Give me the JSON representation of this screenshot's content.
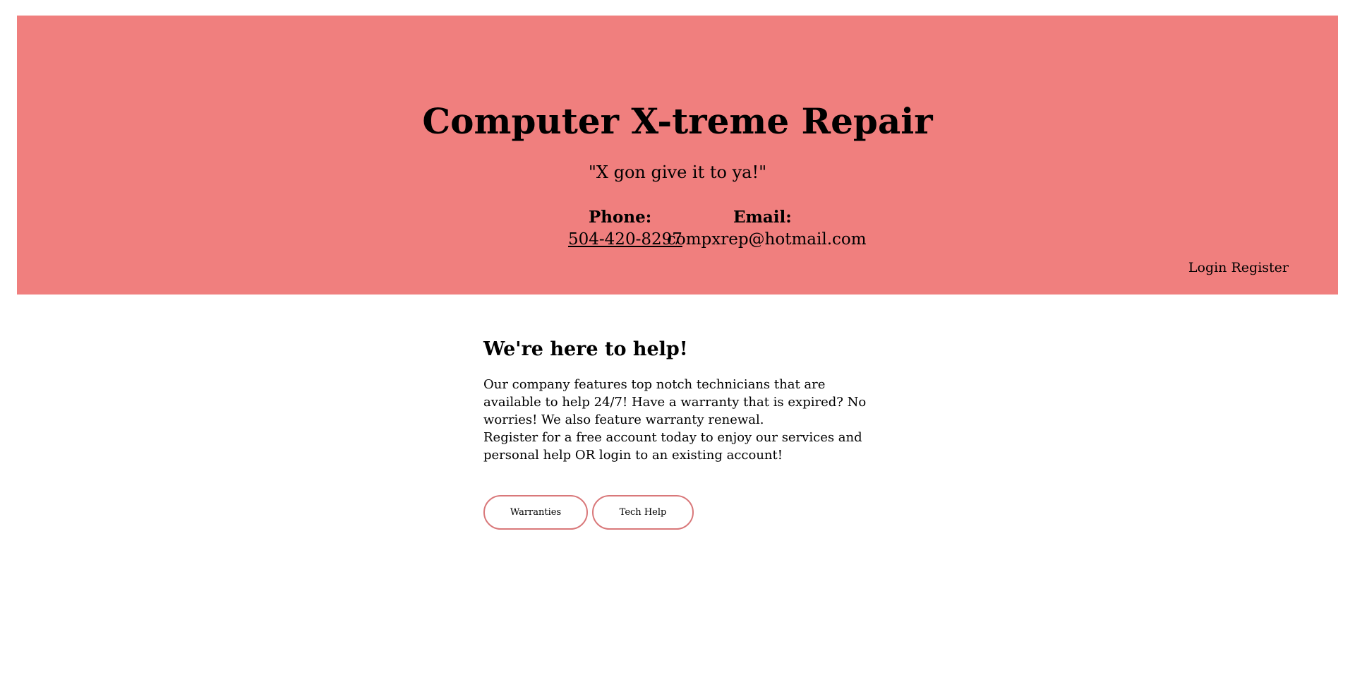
{
  "header": {
    "title": "Computer X-treme Repair",
    "tagline": "\"X gon give it to ya!\"",
    "phone_label": "Phone:",
    "phone_value": "504-420-8297",
    "email_label": "Email:",
    "email_value": "compxrep@hotmail.com",
    "login_label": "Login",
    "register_label": "Register"
  },
  "main": {
    "heading": "We're here to help!",
    "paragraph_1": "Our company features top notch technicians that are available to help 24/7! Have a warranty that is expired? No worries! We also feature warranty renewal.",
    "paragraph_2": "Register for a free account today to enjoy our services and personal help OR login to an existing account!",
    "buttons": [
      {
        "label": "Warranties"
      },
      {
        "label": "Tech Help"
      }
    ]
  },
  "colors": {
    "header_background": "#f07f7e",
    "button_border": "#d9787a"
  }
}
